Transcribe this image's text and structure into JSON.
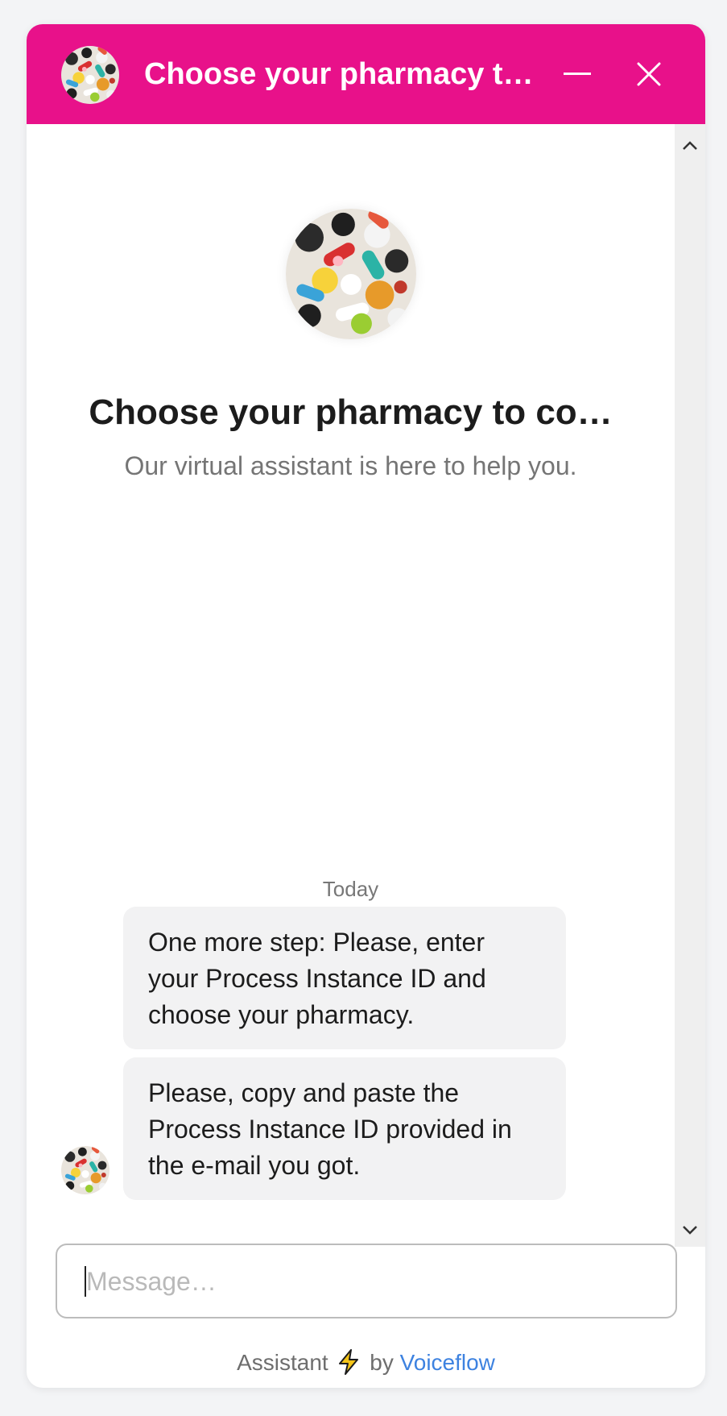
{
  "header": {
    "title": "Choose your pharmacy t…",
    "avatar_icon": "pills-avatar-icon",
    "minimize_icon": "minimize-icon",
    "close_icon": "close-icon"
  },
  "hero": {
    "title": "Choose your pharmacy to co…",
    "subtitle": "Our virtual assistant is here to help you."
  },
  "conversation": {
    "day_label": "Today",
    "messages": [
      {
        "sender": "assistant",
        "text": "One more step: Please, enter your Process Instance ID and choose your pharmacy."
      },
      {
        "sender": "assistant",
        "text": "Please, copy and paste the Process Instance ID provided in the e-mail you got."
      }
    ]
  },
  "composer": {
    "placeholder": "Message…",
    "value": ""
  },
  "footer": {
    "prefix": "Assistant",
    "by": "by",
    "brand": "Voiceflow"
  },
  "colors": {
    "brand": "#e8118a",
    "bubble_bg": "#f2f2f3",
    "link": "#3d82e0"
  }
}
